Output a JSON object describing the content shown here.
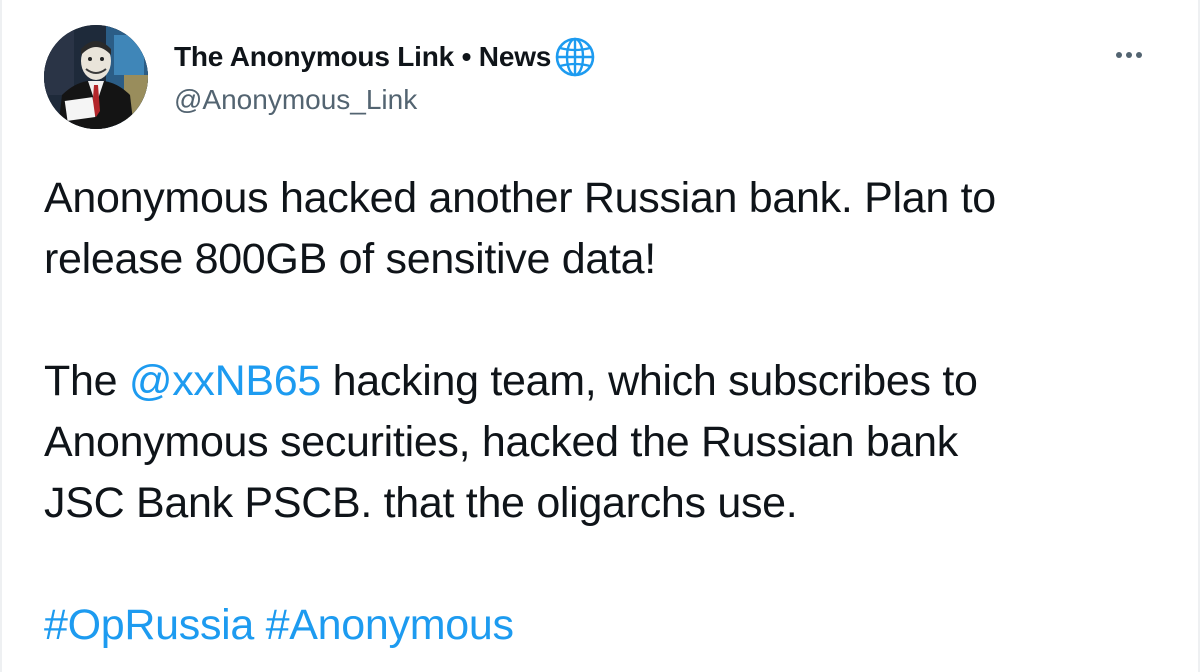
{
  "author": {
    "display_name": "The Anonymous Link • News",
    "handle": "@Anonymous_Link",
    "verified_icon": "globe-icon",
    "avatar_icon": "avatar-man-in-suit-mask"
  },
  "actions": {
    "more_icon": "more-horizontal-icon"
  },
  "tweet": {
    "line1": "Anonymous hacked another Russian bank. Plan to",
    "line2": "release 800GB of sensitive data!",
    "p2_pre": "The ",
    "mention": "@xxNB65",
    "p2_post": " hacking team, which subscribes to",
    "line4": "Anonymous securities, hacked the Russian bank",
    "line5": "JSC Bank PSCB. that the oligarchs use.",
    "hashtag1": "#OpRussia",
    "hashtag_sep": " ",
    "hashtag2": "#Anonymous"
  },
  "colors": {
    "link": "#1d9bf0",
    "secondary_text": "#536471",
    "primary_text": "#0f1419"
  }
}
